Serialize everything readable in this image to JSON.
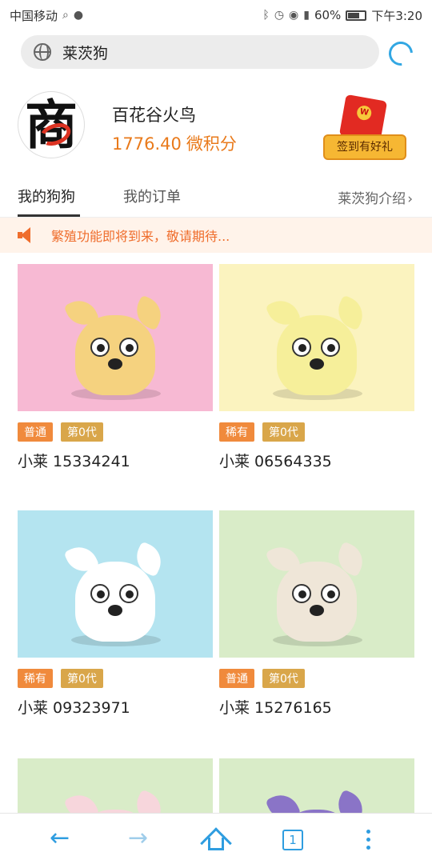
{
  "status_bar": {
    "carrier": "中国移动",
    "battery": "60%",
    "time": "下午3:20"
  },
  "browser": {
    "url_text": "莱茨狗"
  },
  "profile": {
    "avatar_glyph": "商",
    "username": "百花谷火鸟",
    "points_value": "1776.40",
    "points_unit": "微积分",
    "sign_button": "签到有好礼"
  },
  "tabs": {
    "items": [
      "我的狗狗",
      "我的订单"
    ],
    "active_index": 0,
    "right_link": "莱茨狗介绍"
  },
  "notice": {
    "text": "繁殖功能即将到来，敬请期待..."
  },
  "dogs": [
    {
      "rarity": "普通",
      "generation": "第0代",
      "name": "小莱 15334241",
      "bg": "#f7b9d3",
      "fur": "#f5d27f"
    },
    {
      "rarity": "稀有",
      "generation": "第0代",
      "name": "小莱 06564335",
      "bg": "#fbf3bf",
      "fur": "#f6ef9a"
    },
    {
      "rarity": "稀有",
      "generation": "第0代",
      "name": "小莱 09323971",
      "bg": "#b4e4f0",
      "fur": "#ffffff"
    },
    {
      "rarity": "普通",
      "generation": "第0代",
      "name": "小莱 15276165",
      "bg": "#d9ecc8",
      "fur": "#efe6d8"
    },
    {
      "bg": "#d9ecc8",
      "fur": "#f7d6dc"
    },
    {
      "bg": "#d9ecc8",
      "fur": "#8a74c7"
    }
  ],
  "bottom_nav": {
    "tab_count": "1"
  },
  "colors": {
    "accent_orange": "#e97a1b",
    "nav_blue": "#2f9de0"
  }
}
